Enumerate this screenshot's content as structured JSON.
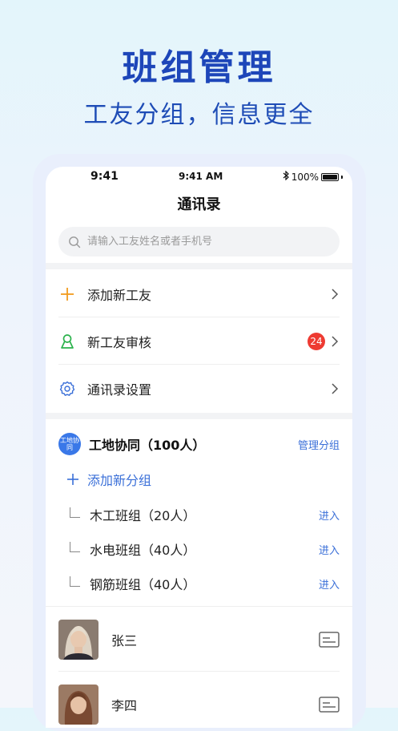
{
  "promo": {
    "title": "班组管理",
    "subtitle": "工友分组，信息更全"
  },
  "status_bar": {
    "time_left": "9:41",
    "time_center": "9:41 AM",
    "battery": "100%"
  },
  "nav": {
    "title": "通讯录"
  },
  "search": {
    "placeholder": "请输入工友姓名或者手机号"
  },
  "menu": [
    {
      "label": "添加新工友",
      "icon": "plus-icon",
      "color": "#f29b1d"
    },
    {
      "label": "新工友审核",
      "icon": "user-review-icon",
      "color": "#2bb24c",
      "badge": "24"
    },
    {
      "label": "通讯录设置",
      "icon": "gear-icon",
      "color": "#3a6fd8"
    }
  ],
  "group": {
    "logo_text": "工地协同",
    "name": "工地协同（100人）",
    "manage_label": "管理分组",
    "add_label": "添加新分组",
    "teams": [
      {
        "name": "木工班组（20人）",
        "action": "进入"
      },
      {
        "name": "水电班组（40人）",
        "action": "进入"
      },
      {
        "name": "钢筋班组（40人）",
        "action": "进入"
      }
    ]
  },
  "contacts": [
    {
      "name": "张三"
    },
    {
      "name": "李四"
    }
  ],
  "colors": {
    "accent": "#3a6fd8",
    "title": "#1d46b9",
    "badge": "#ee3b32"
  }
}
